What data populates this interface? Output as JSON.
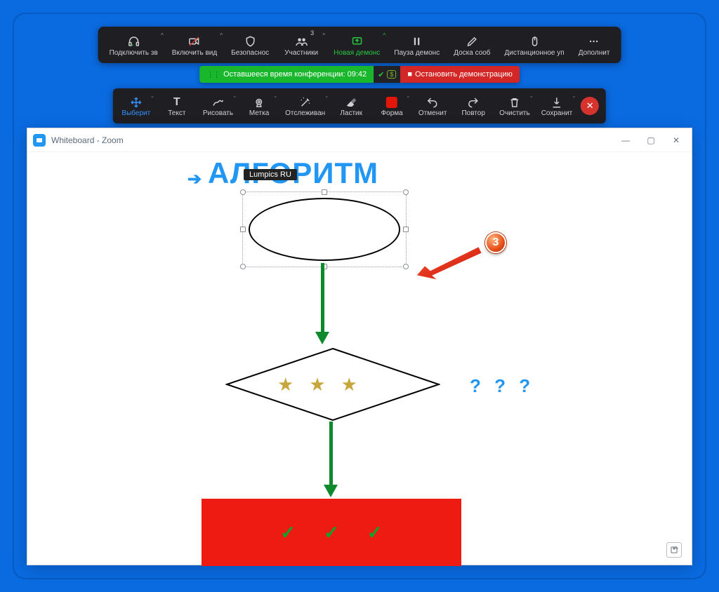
{
  "zoom_bar": {
    "items": [
      {
        "label": "Подключить зв",
        "chev": true
      },
      {
        "label": "Включить вид",
        "chev": true
      },
      {
        "label": "Безопаснос"
      },
      {
        "label": "Участники",
        "badge": "3",
        "chev": true
      },
      {
        "label": "Новая демонс",
        "chev": true,
        "green": true
      },
      {
        "label": "Пауза демонс"
      },
      {
        "label": "Доска сооб"
      },
      {
        "label": "Дистанционное уп"
      },
      {
        "label": "Дополнит"
      }
    ]
  },
  "status": {
    "time_remaining": "Оставшееся время конференции: 09:42",
    "stop_share": "Остановить демонстрацию",
    "dollar": "$"
  },
  "anno_bar": {
    "items": [
      {
        "label": "Выберит",
        "active": true,
        "chev": true
      },
      {
        "label": "Текст"
      },
      {
        "label": "Рисовать",
        "chev": true
      },
      {
        "label": "Метка",
        "chev": true
      },
      {
        "label": "Отслеживан",
        "chev": true
      },
      {
        "label": "Ластик"
      },
      {
        "label": "Форма",
        "chev": true,
        "redsq": true
      },
      {
        "label": "Отменит"
      },
      {
        "label": "Повтор"
      },
      {
        "label": "Очистить",
        "chev": true
      },
      {
        "label": "Сохранит",
        "chev": true
      }
    ]
  },
  "window": {
    "title": "Whiteboard - Zoom"
  },
  "content": {
    "title": "АЛГОРИТМ",
    "username_chip": "Lumpics RU",
    "qmarks": "? ? ?",
    "callout_number": "3"
  }
}
